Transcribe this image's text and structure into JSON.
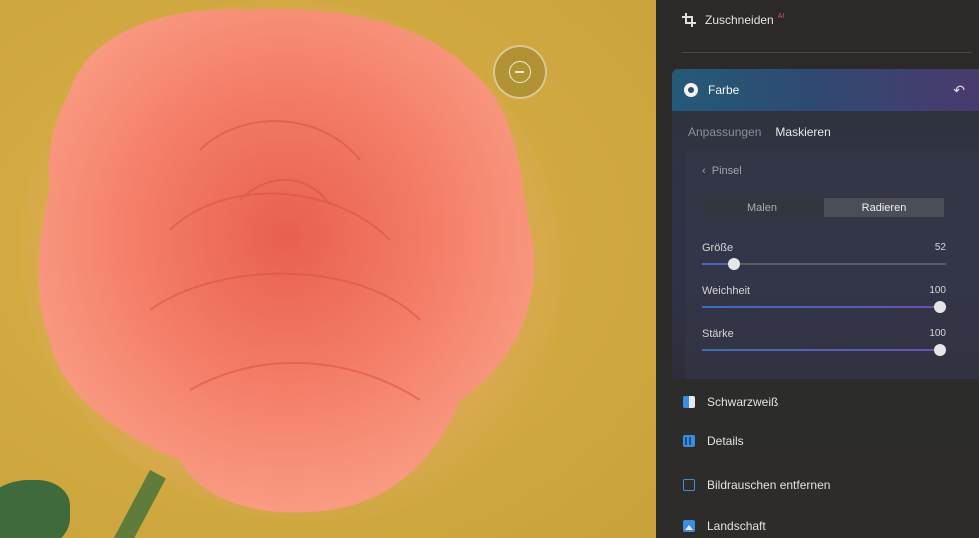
{
  "photo": {
    "alt": ""
  },
  "panel": {
    "crop": {
      "label": "Zuschneiden",
      "badge": "AI"
    },
    "color": {
      "label": "Farbe",
      "tabs": [
        {
          "label": "Anpassungen",
          "active": false
        },
        {
          "label": "Maskieren",
          "active": true
        }
      ],
      "brush": {
        "back_label": "Pinsel",
        "modes": [
          {
            "label": "Malen",
            "active": false
          },
          {
            "label": "Radieren",
            "active": true
          }
        ],
        "sliders": [
          {
            "label": "Größe",
            "value": "52",
            "fraction": 0.13
          },
          {
            "label": "Weichheit",
            "value": "100",
            "fraction": 1.0
          },
          {
            "label": "Stärke",
            "value": "100",
            "fraction": 1.0
          }
        ]
      }
    },
    "features": [
      {
        "label": "Schwarzweiß",
        "icon": "black-white-icon"
      },
      {
        "label": "Details",
        "icon": "details-icon"
      },
      {
        "label": "Bildrauschen entfernen",
        "icon": "noise-reduction-icon"
      },
      {
        "label": "Landschaft",
        "icon": "landscape-icon"
      }
    ]
  }
}
